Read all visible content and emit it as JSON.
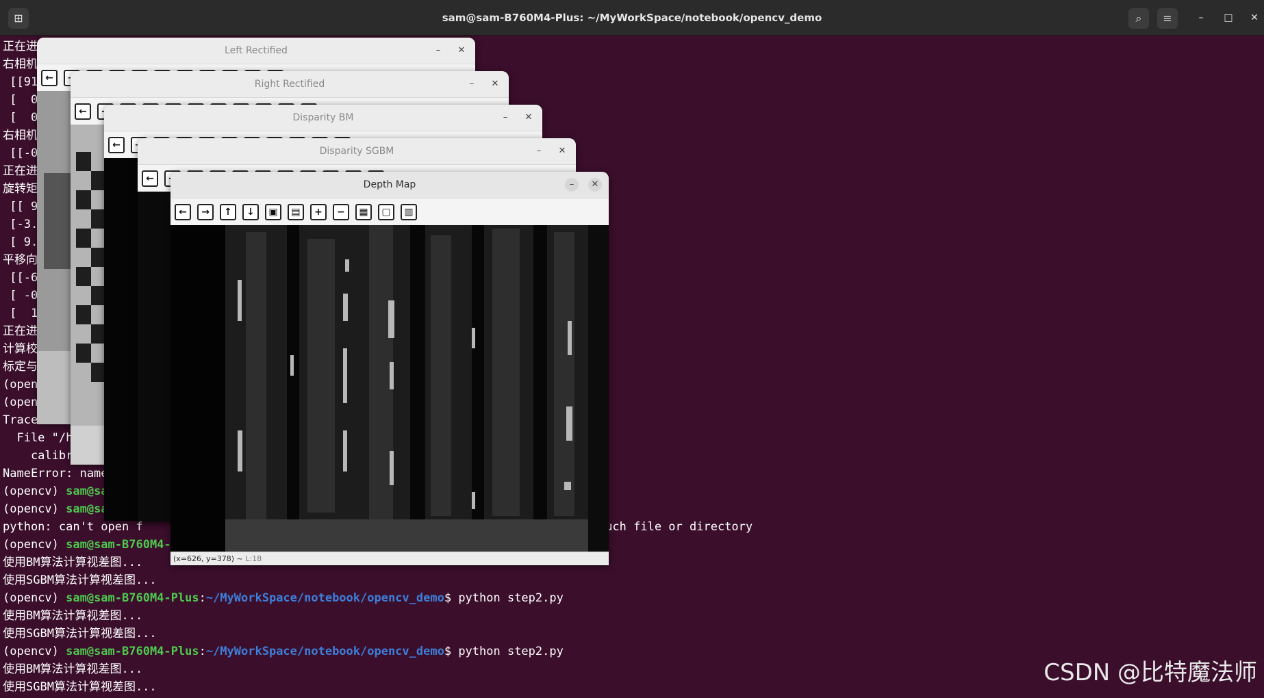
{
  "terminal": {
    "title": "sam@sam-B760M4-Plus: ~/MyWorkSpace/notebook/opencv_demo",
    "lines": [
      {
        "text": "正在进"
      },
      {
        "text": "右相机"
      },
      {
        "text": " [[91"
      },
      {
        "text": " [  0"
      },
      {
        "text": " [  0"
      },
      {
        "text": "右相机"
      },
      {
        "text": " [[-0"
      },
      {
        "text": "正在进"
      },
      {
        "text": "旋转矩"
      },
      {
        "text": " [[ 9"
      },
      {
        "text": " [-3."
      },
      {
        "text": " [ 9."
      },
      {
        "text": "平移向"
      },
      {
        "text": " [[-6"
      },
      {
        "text": " [ -0"
      },
      {
        "text": " [  1"
      },
      {
        "text": "正在进"
      },
      {
        "text": "计算校"
      },
      {
        "text": "标定与"
      },
      {
        "text": "(open"
      },
      {
        "text": "(open"
      },
      {
        "text": "Trace"
      },
      {
        "text": "  File \"/h"
      },
      {
        "text": "    calibr"
      },
      {
        "text": "NameError: name"
      },
      {
        "env": "(opencv) ",
        "user": "sam@sa",
        "path": "",
        "cmd": ""
      },
      {
        "env": "(opencv) ",
        "user": "sam@sam-B76",
        "path": "",
        "cmd": ""
      },
      {
        "text": "python: can't open f                                                                 such file or directory"
      },
      {
        "env": "(opencv) ",
        "user": "sam@sam-B760M4-P",
        "path": "",
        "cmd": ""
      },
      {
        "text": "使用BM算法计算视差图..."
      },
      {
        "text": "使用SGBM算法计算视差图..."
      },
      {
        "env": "(opencv) ",
        "user": "sam@sam-B760M4-Plus",
        "sep": ":",
        "path": "~/MyWorkSpace/notebook/opencv_demo",
        "cmd": "$ python step2.py"
      },
      {
        "text": "使用BM算法计算视差图..."
      },
      {
        "text": "使用SGBM算法计算视差图..."
      },
      {
        "env": "(opencv) ",
        "user": "sam@sam-B760M4-Plus",
        "sep": ":",
        "path": "~/MyWorkSpace/notebook/opencv_demo",
        "cmd": "$ python step2.py"
      },
      {
        "text": "使用BM算法计算视差图..."
      },
      {
        "text": "使用SGBM算法计算视差图..."
      }
    ]
  },
  "windows": [
    {
      "title": "Left Rectified"
    },
    {
      "title": "Right Rectified"
    },
    {
      "title": "Disparity BM"
    },
    {
      "title": "Disparity SGBM"
    },
    {
      "title": "Depth Map"
    }
  ],
  "depth_map": {
    "status_coords": "(x=626, y=378) ~",
    "status_value": "L:18"
  },
  "toolbar_icons": [
    "arrow-left-icon",
    "arrow-right-icon",
    "arrow-up-icon",
    "arrow-down-icon",
    "zoom-fit-icon",
    "zoom-original-icon",
    "zoom-in-icon",
    "zoom-out-icon",
    "save-icon",
    "copy-icon",
    "properties-icon"
  ],
  "watermark": "CSDN @比特魔法师",
  "colors": {
    "terminal_bg": "#3b0e2c",
    "prompt_user": "#4ec94e",
    "prompt_path": "#3d7fd9"
  }
}
